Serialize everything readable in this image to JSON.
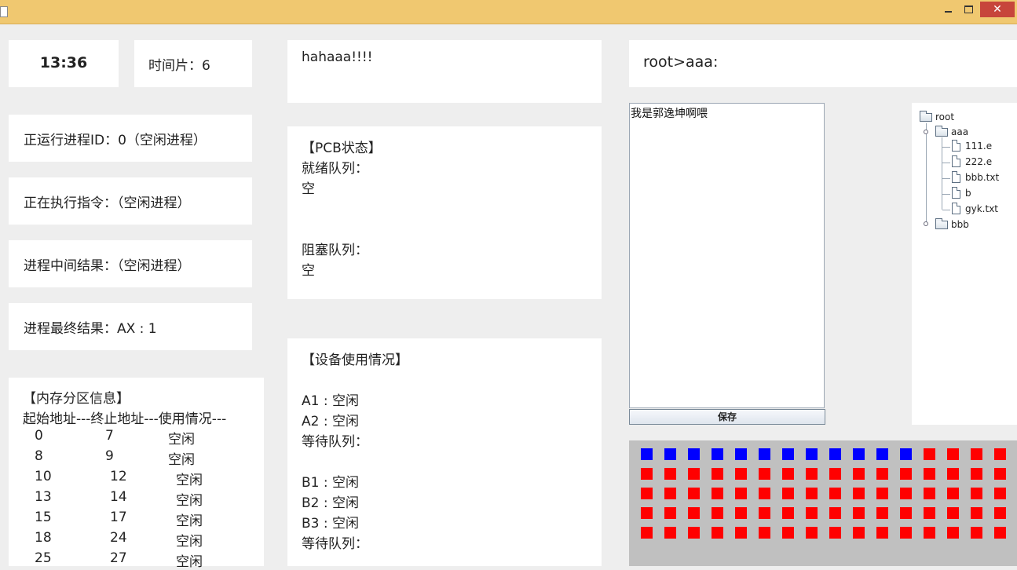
{
  "window": {
    "minimize": "—",
    "close": "✕"
  },
  "status": {
    "clock": "13:36",
    "time_slice": "时间片：6",
    "running_process": "正运行进程ID：0（空闲进程）",
    "current_instruction": "正在执行指令：（空闲进程）",
    "intermediate_result": "进程中间结果：（空闲进程）",
    "final_result": "进程最终结果：AX : 1"
  },
  "memory": {
    "title": "【内存分区信息】",
    "header": "起始地址---终止地址---使用情况---",
    "rows": [
      {
        "start": "0",
        "end": "7",
        "usage": "空闲"
      },
      {
        "start": "8",
        "end": "9",
        "usage": "空闲"
      },
      {
        "start": "10",
        "end": "12",
        "usage": "空闲"
      },
      {
        "start": "13",
        "end": "14",
        "usage": "空闲"
      },
      {
        "start": "15",
        "end": "17",
        "usage": "空闲"
      },
      {
        "start": "18",
        "end": "24",
        "usage": "空闲"
      },
      {
        "start": "25",
        "end": "27",
        "usage": "空闲"
      }
    ]
  },
  "message": "hahaaa!!!!",
  "pcb": {
    "title": "【PCB状态】",
    "ready_label": "就绪队列：",
    "ready_value": "空",
    "blocked_label": "阻塞队列：",
    "blocked_value": "空"
  },
  "devices": {
    "title": "【设备使用情况】",
    "a1": "A1 : 空闲",
    "a2": "A2 : 空闲",
    "a_wait": "等待队列：",
    "b1": "B1 : 空闲",
    "b2": "B2 : 空闲",
    "b3": "B3 : 空闲",
    "b_wait": "等待队列："
  },
  "path": "root>aaa:",
  "editor": {
    "content": "我是郭逸坤啊喂"
  },
  "save_label": "保存",
  "tree": {
    "root": "root",
    "aaa": "aaa",
    "files": [
      "111.e",
      "222.e",
      "bbb.txt",
      "b",
      "gyk.txt"
    ],
    "bbb": "bbb"
  },
  "disk": {
    "colors": {
      "used": "#0000ff",
      "free": "#ff0000"
    },
    "used_blocks_first_row": 12,
    "columns": 16,
    "rows": 5
  }
}
